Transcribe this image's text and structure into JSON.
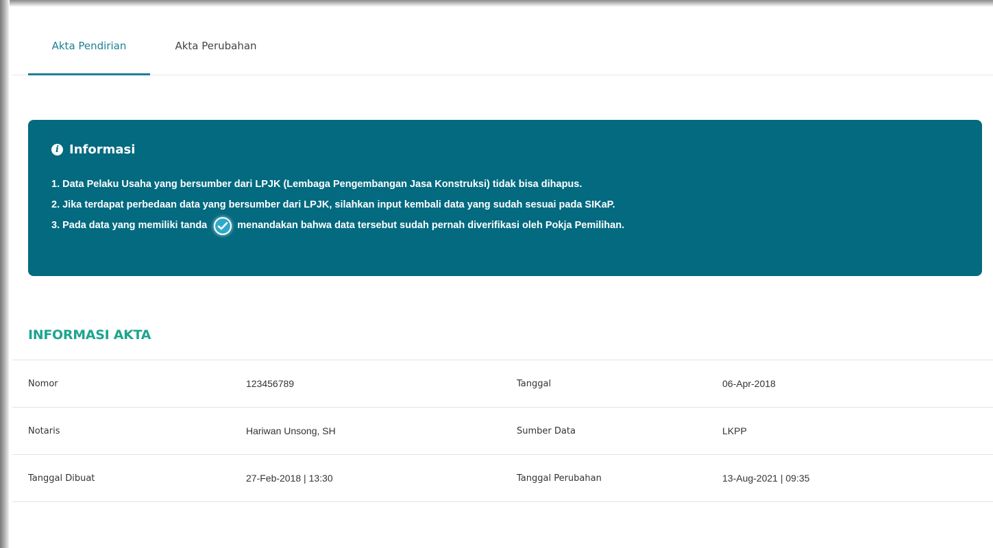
{
  "tabs": [
    {
      "label": "Akta Pendirian",
      "active": true
    },
    {
      "label": "Akta Perubahan",
      "active": false
    }
  ],
  "info": {
    "title": "Informasi",
    "icon": "info-circle-icon",
    "items": [
      "1. Data Pelaku Usaha yang bersumber dari LPJK (Lembaga Pengembangan Jasa Konstruksi) tidak bisa dihapus.",
      "2. Jika terdapat perbedaan data yang bersumber dari LPJK, silahkan input kembali data yang sudah sesuai pada SIKaP."
    ],
    "item3_prefix": "3. Pada data yang memiliki tanda",
    "item3_suffix": "menandakan bahwa data tersebut sudah pernah diverifikasi oleh Pokja Pemilihan.",
    "verified_icon": "verified-check-icon"
  },
  "section": {
    "title": "INFORMASI AKTA"
  },
  "rows": [
    {
      "label1": "Nomor",
      "value1": "123456789",
      "label2": "Tanggal",
      "value2": "06-Apr-2018"
    },
    {
      "label1": "Notaris",
      "value1": "Hariwan Unsong, SH",
      "label2": "Sumber Data",
      "value2": "LKPP"
    },
    {
      "label1": "Tanggal Dibuat",
      "value1": "27-Feb-2018 | 13:30",
      "label2": "Tanggal Perubahan",
      "value2": "13-Aug-2021 | 09:35"
    }
  ],
  "colors": {
    "accent": "#1a7f95",
    "info_bg": "#036a80",
    "section_title": "#1ea48f"
  }
}
